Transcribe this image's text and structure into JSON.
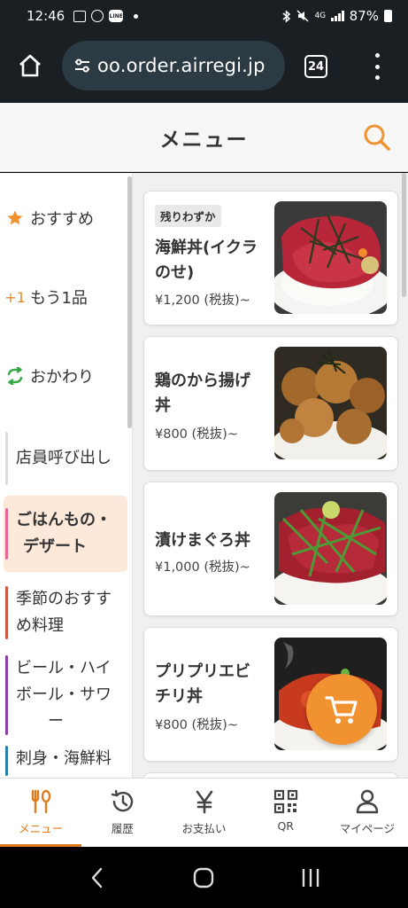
{
  "status_bar": {
    "time": "12:46",
    "net_label": "4G",
    "battery": "87%"
  },
  "browser": {
    "url": "oo.order.airregi.jp",
    "tab_count": "24"
  },
  "header": {
    "title": "メニュー"
  },
  "sidebar": {
    "quick": [
      {
        "icon": "star-icon",
        "mark": "★",
        "label": "おすすめ",
        "color": "#f0922f"
      },
      {
        "icon": "plus-one-icon",
        "mark": "+1",
        "label": "もう1品",
        "color": "#e08a2a"
      },
      {
        "icon": "refresh-icon",
        "mark": "",
        "label": "おかわり",
        "color": "#3aa64a"
      }
    ],
    "call_staff": "店員呼び出し",
    "categories": [
      {
        "label_line1": "ごはんもの・",
        "label_line2": "デザート",
        "color": "#e8659a",
        "active": true
      },
      {
        "label_line1": "季節のおすす",
        "label_line2": "め料理",
        "color": "#d2563c",
        "active": false
      },
      {
        "label_line1": "ビール・ハイ",
        "label_line2": "ボール・サワ",
        "label_line3": "ー",
        "color": "#8b3fa6",
        "active": false
      },
      {
        "label_line1": "刺身・海鮮料",
        "label_line2": "",
        "color": "#2a7fa8",
        "active": false
      }
    ]
  },
  "menu_items": [
    {
      "badge": "残りわずか",
      "name_line1": "海鮮丼(イクラ",
      "name_line2": "のせ)",
      "price": "¥1,200 (税抜)~",
      "image": "kaisendon"
    },
    {
      "badge": "",
      "name_line1": "鶏のから揚げ",
      "name_line2": "丼",
      "price": "¥800 (税抜)~",
      "image": "karaage-don"
    },
    {
      "badge": "",
      "name_line1": "漬けまぐろ丼",
      "name_line2": "",
      "price": "¥1,000 (税抜)~",
      "image": "maguro-don"
    },
    {
      "badge": "",
      "name_line1": "プリプリエビ",
      "name_line2": "チリ丼",
      "price": "¥800 (税抜)~",
      "image": "ebichiri-don"
    }
  ],
  "tabbar": {
    "tabs": [
      {
        "label": "メニュー",
        "icon": "fork-knife-icon",
        "active": true
      },
      {
        "label": "履歴",
        "icon": "history-icon",
        "active": false
      },
      {
        "label": "お支払い",
        "icon": "yen-icon",
        "active": false
      },
      {
        "label": "QR",
        "icon": "qr-code-icon",
        "active": false
      },
      {
        "label": "マイページ",
        "icon": "person-icon",
        "active": false
      }
    ]
  },
  "colors": {
    "accent": "#f0922f",
    "active_tab": "#e27a1e",
    "active_category_bg": "#fde9d9"
  }
}
